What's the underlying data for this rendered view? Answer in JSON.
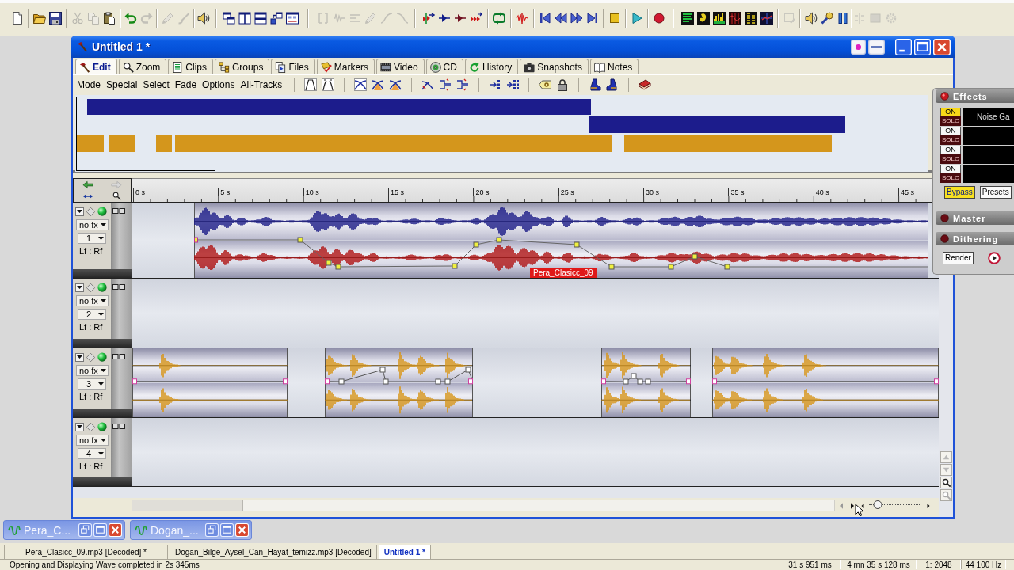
{
  "toolbar": [
    {
      "disabled": false
    },
    {
      "disabled": false
    },
    {
      "disabled": false
    },
    {
      "disabled": true
    },
    {
      "disabled": true
    },
    {
      "disabled": false
    },
    {
      "disabled": false
    },
    {
      "disabled": true
    },
    {
      "disabled": true
    },
    {
      "disabled": true
    },
    {
      "disabled": false
    },
    {
      "disabled": false
    },
    {
      "disabled": false
    },
    {
      "disabled": false
    },
    {
      "disabled": false
    },
    {
      "disabled": false
    },
    {
      "disabled": true
    },
    {
      "disabled": true
    },
    {
      "disabled": true
    },
    {
      "disabled": true
    },
    {
      "disabled": true
    },
    {
      "disabled": true
    },
    {
      "disabled": false
    },
    {
      "disabled": false
    },
    {
      "disabled": false
    },
    {
      "disabled": false
    },
    {
      "disabled": false
    },
    {
      "disabled": false
    },
    {
      "disabled": false
    },
    {
      "disabled": false
    },
    {
      "disabled": false
    },
    {
      "disabled": false
    },
    {
      "disabled": false
    },
    {
      "disabled": false
    },
    {
      "disabled": false
    },
    {
      "disabled": false
    },
    {
      "disabled": false
    },
    {
      "disabled": false
    },
    {
      "disabled": false
    },
    {
      "disabled": false
    },
    {
      "disabled": false
    },
    {
      "disabled": true
    },
    {
      "disabled": false
    },
    {
      "disabled": false
    },
    {
      "disabled": false
    },
    {
      "disabled": true
    },
    {
      "disabled": true
    },
    {
      "disabled": true
    }
  ],
  "window": {
    "title": "Untitled 1 *"
  },
  "tabs": [
    {
      "label": "Edit",
      "selected": true
    },
    {
      "label": "Zoom",
      "selected": false
    },
    {
      "label": "Clips",
      "selected": false
    },
    {
      "label": "Groups",
      "selected": false
    },
    {
      "label": "Files",
      "selected": false
    },
    {
      "label": "Markers",
      "selected": false
    },
    {
      "label": "Video",
      "selected": false
    },
    {
      "label": "CD",
      "selected": false
    },
    {
      "label": "History",
      "selected": false
    },
    {
      "label": "Snapshots",
      "selected": false
    },
    {
      "label": "Notes",
      "selected": false
    }
  ],
  "menu": [
    "Mode",
    "Special",
    "Select",
    "Fade",
    "Options",
    "All-Tracks"
  ],
  "ruler": [
    "0 s",
    "5 s",
    "10 s",
    "15 s",
    "20 s",
    "25 s",
    "30 s",
    "35 s",
    "40 s",
    "45 s"
  ],
  "tracks": [
    {
      "fx": "no fx",
      "number": "1",
      "pan": "Lf : Rf",
      "clips": [
        {
          "kind": "stereo",
          "label": "Pera_Clasicc_09"
        }
      ]
    },
    {
      "fx": "no fx",
      "number": "2",
      "pan": "Lf : Rf"
    },
    {
      "fx": "no fx",
      "number": "3",
      "pan": "Lf : Rf",
      "clips": [
        {
          "kind": "mono"
        },
        {
          "kind": "mono"
        },
        {
          "kind": "mono"
        },
        {
          "kind": "mono"
        }
      ]
    },
    {
      "fx": "no fx",
      "number": "4",
      "pan": "Lf : Rf"
    }
  ],
  "zoom_slider": {
    "level": 0.17
  },
  "effects": {
    "title": "Effects",
    "slots": [
      {
        "on_label": "ON",
        "on": true,
        "solo_label": "SOLO",
        "effect": "Noise Ga"
      },
      {
        "on_label": "ON",
        "on": false,
        "solo_label": "SOLO"
      },
      {
        "on_label": "ON",
        "on": false,
        "solo_label": "SOLO"
      },
      {
        "on_label": "ON",
        "on": false,
        "solo_label": "SOLO"
      }
    ],
    "bypass": {
      "label": "Bypass",
      "on": true
    },
    "presets": "Presets",
    "master": "Master",
    "dithering": "Dithering",
    "render": "Render"
  },
  "minimized_windows": [
    {
      "title": "Pera_C..."
    },
    {
      "title": "Dogan_..."
    }
  ],
  "document_tabs": [
    {
      "label": "Pera_Clasicc_09.mp3 [Decoded] *",
      "selected": false
    },
    {
      "label": "Dogan_Bilge_Aysel_Can_Hayat_temizz.mp3 [Decoded]",
      "selected": false
    },
    {
      "label": "Untitled 1 *",
      "selected": true
    }
  ],
  "status_bar": {
    "message": "Opening and Displaying Wave completed in 2s 345ms",
    "fields": [
      "31 s 951 ms",
      "4 mn 35 s 128 ms",
      "1: 2048",
      "44 100 Hz"
    ]
  }
}
